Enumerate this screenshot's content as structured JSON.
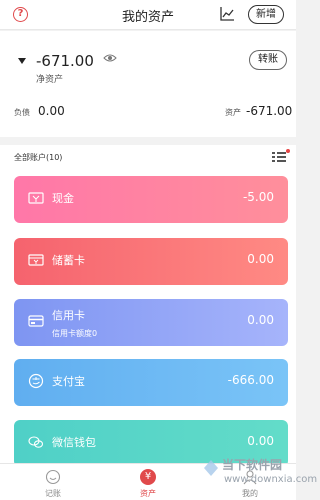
{
  "header": {
    "title": "我的资产",
    "add_label": "新增",
    "help_glyph": "?"
  },
  "summary": {
    "net_value": "-671.00",
    "net_label": "净资产",
    "transfer_label": "转账",
    "liabilities_label": "负债",
    "liabilities_value": "0.00",
    "assets_label": "资产",
    "assets_value": "-671.00"
  },
  "accounts": {
    "title": "全部账户(10)",
    "items": [
      {
        "name": "现金",
        "amount": "-5.00",
        "icon": "cash-icon",
        "color_start": "#ff77a8",
        "color_end": "#ff8f9b"
      },
      {
        "name": "储蓄卡",
        "amount": "0.00",
        "icon": "savings-card-icon",
        "color_start": "#f5636e",
        "color_end": "#ff8a84"
      },
      {
        "name": "信用卡",
        "sub": "信用卡额度0",
        "amount": "0.00",
        "icon": "credit-card-icon",
        "color_start": "#7e95f2",
        "color_end": "#a6b4fb"
      },
      {
        "name": "支付宝",
        "amount": "-666.00",
        "icon": "alipay-icon",
        "color_start": "#60aef0",
        "color_end": "#7ac4f7"
      },
      {
        "name": "微信钱包",
        "amount": "0.00",
        "icon": "wechat-icon",
        "color_start": "#4fd0c7",
        "color_end": "#63dcc9"
      }
    ]
  },
  "tabbar": {
    "items": [
      {
        "label": "记账"
      },
      {
        "label": "资产"
      },
      {
        "label": "我的"
      }
    ],
    "active": 1,
    "asset_glyph": "¥"
  },
  "watermark": {
    "text": "当下软件园",
    "url": "www.downxia.com"
  },
  "colors": {
    "accent": "#e0494b"
  }
}
